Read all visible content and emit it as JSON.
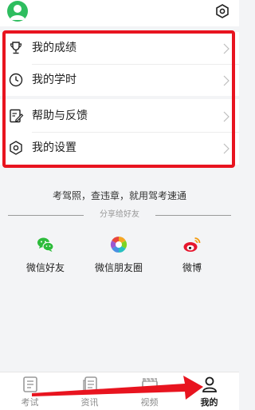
{
  "header": {
    "avatar_icon": "user-avatar-icon",
    "settings_icon": "settings-hexagon-icon"
  },
  "menu": {
    "group1": [
      {
        "label": "我的成绩",
        "icon": "trophy-icon"
      },
      {
        "label": "我的学时",
        "icon": "clock-icon"
      }
    ],
    "group2": [
      {
        "label": "帮助与反馈",
        "icon": "edit-note-icon"
      },
      {
        "label": "我的设置",
        "icon": "settings-hexagon-icon"
      }
    ]
  },
  "slogan": "考驾照，查违章，就用驾考速通",
  "share": {
    "title": "分享给好友",
    "items": [
      {
        "label": "微信好友",
        "icon": "wechat-icon"
      },
      {
        "label": "微信朋友圈",
        "icon": "moments-icon"
      },
      {
        "label": "微博",
        "icon": "weibo-icon"
      }
    ]
  },
  "tabbar": {
    "tabs": [
      {
        "label": "考试",
        "icon": "exam-icon"
      },
      {
        "label": "资讯",
        "icon": "news-icon"
      },
      {
        "label": "视频",
        "icon": "video-icon"
      },
      {
        "label": "我的",
        "icon": "profile-icon"
      }
    ],
    "active": "我的"
  },
  "colors": {
    "accent_green": "#2ebd5f",
    "annotation_red": "#e8141f",
    "background": "#f3f4f6"
  }
}
